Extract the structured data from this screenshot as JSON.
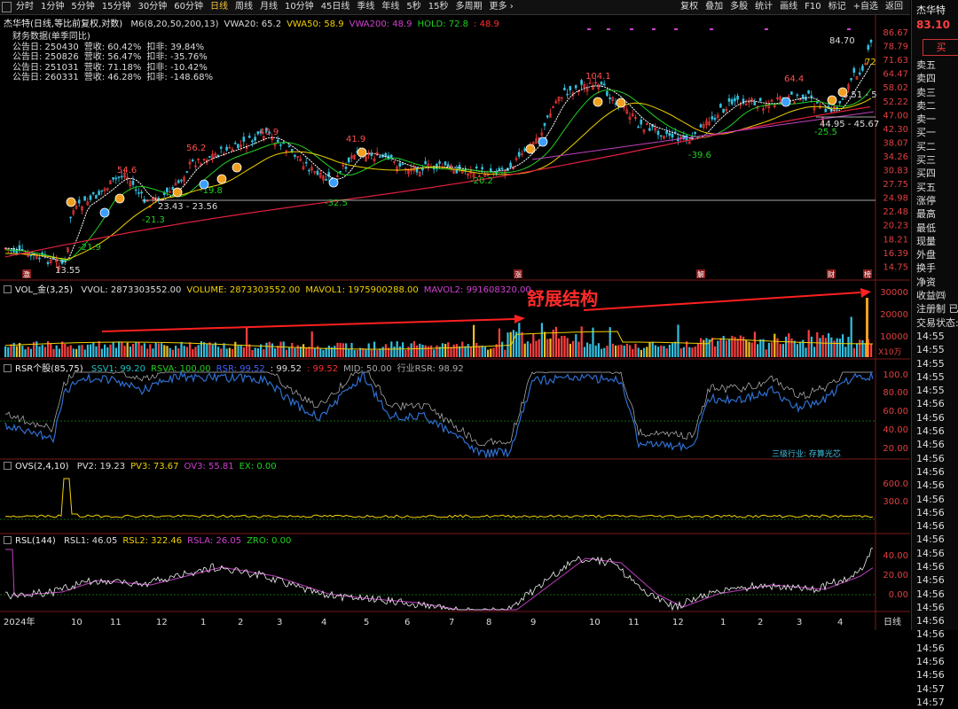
{
  "toolbar": {
    "periods": [
      "分时",
      "1分钟",
      "5分钟",
      "15分钟",
      "30分钟",
      "60分钟",
      "日线",
      "周线",
      "月线",
      "10分钟",
      "45日线",
      "季线",
      "年线",
      "5秒",
      "15秒",
      "多周期",
      "更多 ›"
    ],
    "active_period": "日线",
    "tools": [
      "复权",
      "叠加",
      "多股",
      "统计",
      "画线",
      "F10",
      "标记",
      "+自选",
      "返回"
    ]
  },
  "main_chart": {
    "title": "杰华特(日线,等比前复权,对数)",
    "indicators": [
      {
        "label": "M6(8,20,50,200,13)",
        "color": "#dddddd"
      },
      {
        "label": "VWA20: 65.2",
        "color": "#dddddd"
      },
      {
        "label": "VWA50: 58.9",
        "color": "#f0d000"
      },
      {
        "label": "VWA200: 48.9",
        "color": "#d040d0"
      },
      {
        "label": "HOLD: 72.8",
        "color": "#20d020"
      },
      {
        "label": ": 48.9",
        "color": "#ff3030"
      }
    ],
    "finance_title": "财务数据(单季同比)",
    "finance_rows": [
      {
        "date": "公告日: 250430",
        "rev": "营收: 60.42%",
        "net": "扣非: 39.84%"
      },
      {
        "date": "公告日: 250826",
        "rev": "营收: 56.47%",
        "net": "扣非: -35.76%"
      },
      {
        "date": "公告日: 251031",
        "rev": "营收: 71.18%",
        "net": "扣非: -10.42%"
      },
      {
        "date": "公告日: 260331",
        "rev": "营收: 46.28%",
        "net": "扣非: -148.68%"
      }
    ],
    "price_axis": [
      "86.67",
      "78.79",
      "71.63",
      "64.47",
      "58.02",
      "52.22",
      "47.00",
      "42.30",
      "38.07",
      "34.26",
      "30.83",
      "27.75",
      "24.98",
      "22.48",
      "20.23",
      "18.21",
      "16.39",
      "14.75"
    ],
    "annotations": [
      "13.55",
      "-21.9",
      "54.6",
      "56.2",
      "-21.3",
      "-19.8",
      "23.43 - 23.56",
      "40.9",
      "41.9",
      "-32.5",
      "-20.2",
      "104.1",
      "-39.6",
      "64.4",
      "-25.5",
      "44.95 - 45.67",
      "84.70",
      "72",
      "3.51 - 5"
    ],
    "event_markers": [
      "激",
      "涨",
      "解",
      "财",
      "榜"
    ]
  },
  "volume_pane": {
    "label": "VOL_金(3,25)",
    "values": [
      {
        "label": "VVOL: 2873303552.00",
        "color": "#dddddd"
      },
      {
        "label": "VOLUME: 2873303552.00",
        "color": "#f0d000"
      },
      {
        "label": "MAVOL1: 1975900288.00",
        "color": "#f0d000"
      },
      {
        "label": "MAVOL2: 991608320.00",
        "color": "#d040d0"
      }
    ],
    "annotation": "舒展结构",
    "axis": [
      "30000",
      "20000",
      "10000"
    ],
    "unit": "X10万"
  },
  "rsr_pane": {
    "label": "RSR个股(85,75)",
    "values": [
      {
        "label": "SSV1: 99.20",
        "color": "#20c0c0"
      },
      {
        "label": "RSVA: 100.00",
        "color": "#20d020"
      },
      {
        "label": "RSR: 99.52",
        "color": "#4060ff"
      },
      {
        "label": ": 99.52",
        "color": "#dddddd"
      },
      {
        "label": ": 99.52",
        "color": "#ff3030"
      },
      {
        "label": "MID: 50.00",
        "color": "#aaaaaa"
      },
      {
        "label": "行业RSR: 98.92",
        "color": "#aaaaaa"
      }
    ],
    "axis": [
      "100.0",
      "80.00",
      "60.00",
      "40.00",
      "20.00"
    ],
    "industry": "三级行业: 存算光芯"
  },
  "ovs_pane": {
    "label": "OVS(2,4,10)",
    "values": [
      {
        "label": "PV2: 19.23",
        "color": "#dddddd"
      },
      {
        "label": "PV3: 73.67",
        "color": "#f0d000"
      },
      {
        "label": "OV3: 55.81",
        "color": "#d040d0"
      },
      {
        "label": "EX: 0.00",
        "color": "#20d020"
      }
    ],
    "axis": [
      "600.0",
      "300.0"
    ]
  },
  "rsl_pane": {
    "label": "RSL(144)",
    "values": [
      {
        "label": "RSL1: 46.05",
        "color": "#dddddd"
      },
      {
        "label": "RSL2: 322.46",
        "color": "#f0d000"
      },
      {
        "label": "RSLA: 26.05",
        "color": "#d040d0"
      },
      {
        "label": "ZRO: 0.00",
        "color": "#20d020"
      }
    ],
    "axis": [
      "40.00",
      "20.00",
      "0.00"
    ]
  },
  "time_axis": {
    "labels": [
      "2024年",
      "10",
      "11",
      "12",
      "1",
      "2",
      "3",
      "4",
      "5",
      "6",
      "7",
      "8",
      "9",
      "10",
      "11",
      "12",
      "1",
      "2",
      "3",
      "4"
    ],
    "period_label": "日线"
  },
  "right_panel": {
    "name": "杰华特",
    "price": "83.10",
    "buy_label": "买",
    "items": [
      "卖五",
      "卖四",
      "卖三",
      "卖二",
      "卖一",
      "买一",
      "买二",
      "买三",
      "买四",
      "买五",
      "涨停",
      "最高",
      "最低",
      "现量",
      "外盘",
      "换手",
      "净资",
      "收益㈣",
      "注册制 已",
      "交易状态:",
      "14:55",
      "14:55",
      "14:55",
      "14:55",
      "14:55",
      "14:56",
      "14:56",
      "14:56",
      "14:56",
      "14:56",
      "14:56",
      "14:56",
      "14:56",
      "14:56",
      "14:56",
      "14:56",
      "14:56",
      "14:56",
      "14:56",
      "14:56",
      "14:56",
      "14:56",
      "14:56",
      "14:56",
      "14:56",
      "14:56",
      "14:57",
      "14:57"
    ]
  }
}
